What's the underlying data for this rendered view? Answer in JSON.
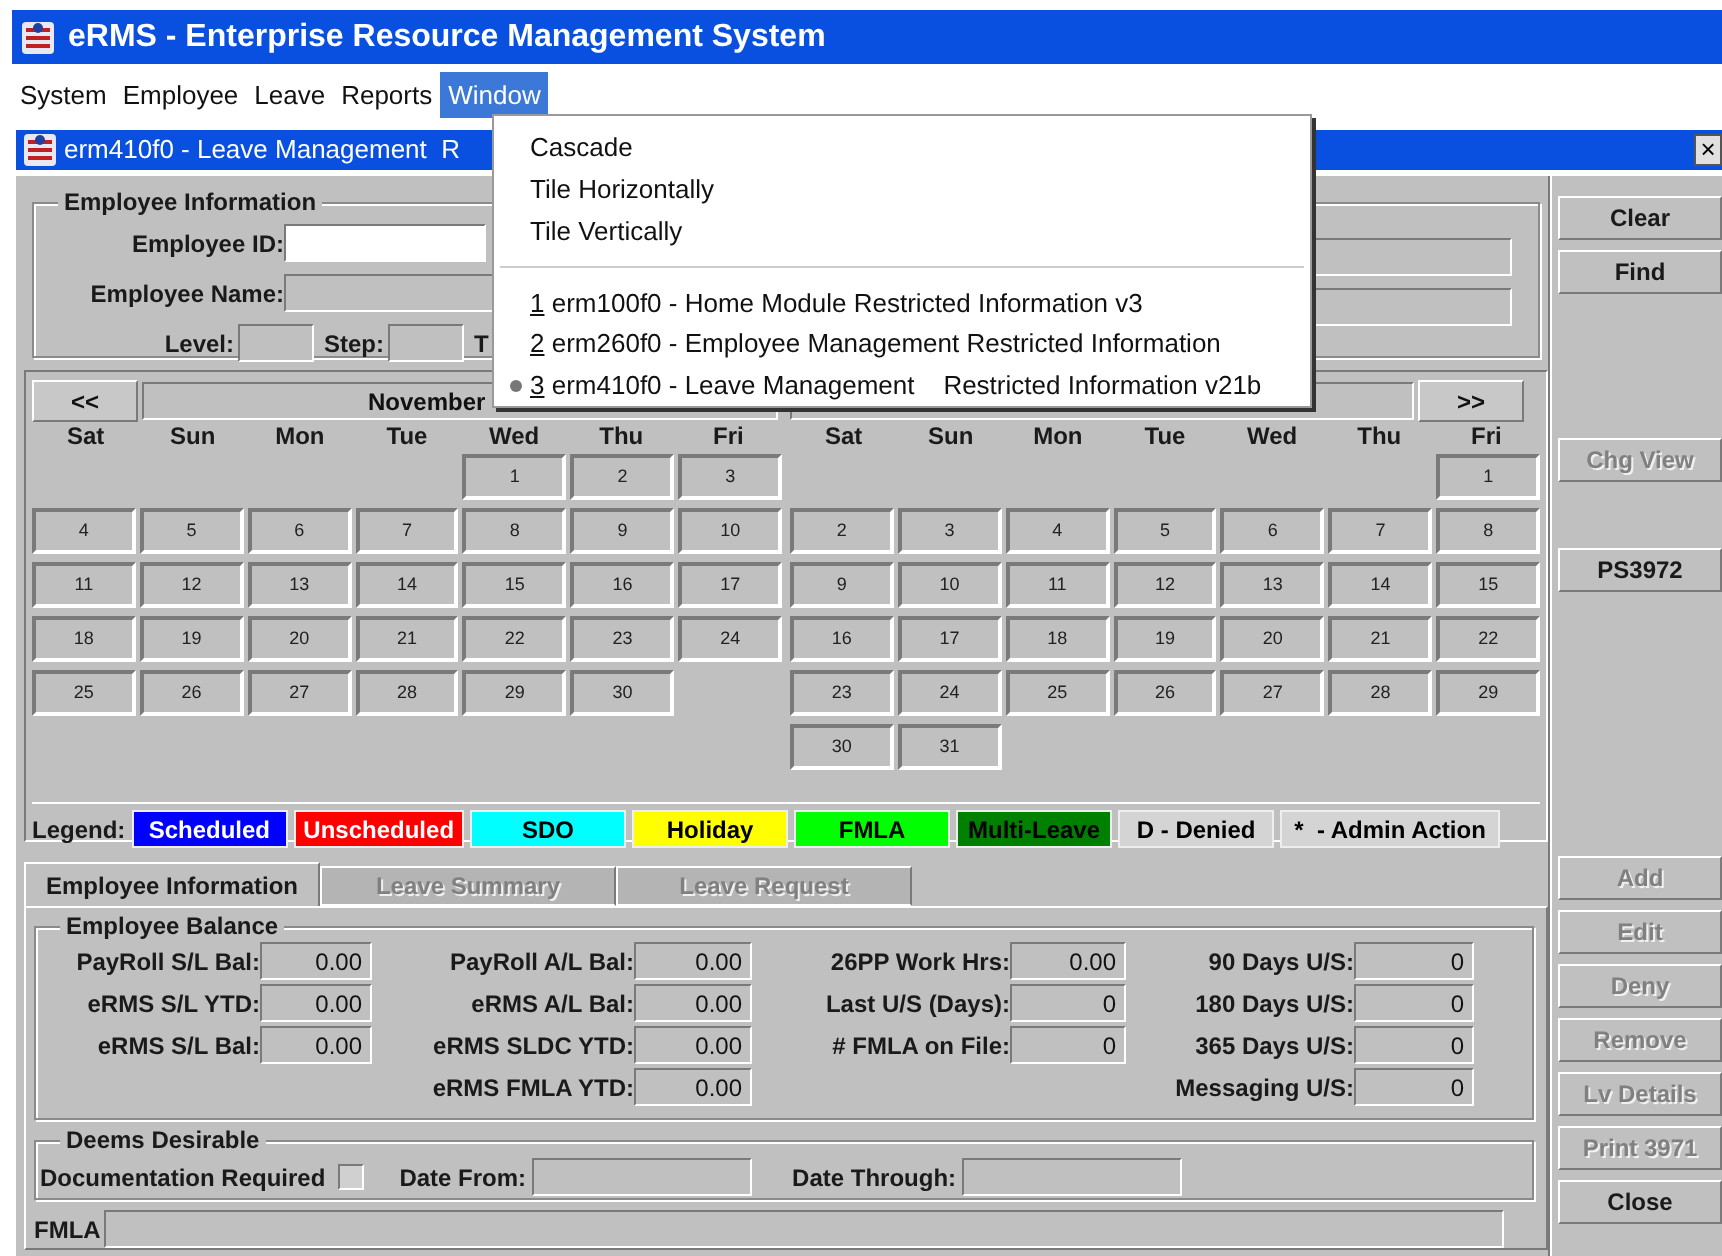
{
  "window": {
    "title": "eRMS - Enterprise Resource Management System"
  },
  "menu_bar": [
    {
      "label": "System",
      "selected": false
    },
    {
      "label": "Employee",
      "selected": false
    },
    {
      "label": "Leave",
      "selected": false
    },
    {
      "label": "Reports",
      "selected": false
    },
    {
      "label": "Window",
      "selected": true
    }
  ],
  "window_menu": {
    "commands": [
      "Cascade",
      "Tile Horizontally",
      "Tile Vertically"
    ],
    "windows": [
      {
        "mnemonic": "1",
        "label": "erm100f0 - Home Module Restricted Information v3",
        "active": false
      },
      {
        "mnemonic": "2",
        "label": "erm260f0 - Employee Management Restricted Information",
        "active": false
      },
      {
        "mnemonic": "3",
        "label": "erm410f0 - Leave Management    Restricted Information v21b",
        "active": true
      }
    ]
  },
  "inner_window": {
    "title": "erm410f0 - Leave Management  R",
    "close": "×"
  },
  "employee_information": {
    "title": "Employee Information",
    "id_label": "Employee ID:",
    "name_label": "Employee Name:",
    "level_label": "Level:",
    "step_label": "Step:",
    "label_4": "T"
  },
  "calendar": {
    "prev": "<<",
    "next": ">>",
    "months": [
      {
        "header": "November",
        "weekdays": [
          "Sat",
          "Sun",
          "Mon",
          "Tue",
          "Wed",
          "Thu",
          "Fri"
        ],
        "weeks": [
          [
            {
              "kind": "blank"
            },
            {
              "kind": "blank"
            },
            {
              "kind": "blank"
            },
            {
              "kind": "blank"
            },
            {
              "kind": "day",
              "label": "1"
            },
            {
              "kind": "day",
              "label": "2"
            },
            {
              "kind": "day",
              "label": "3"
            }
          ],
          [
            {
              "kind": "day",
              "label": "4"
            },
            {
              "kind": "day",
              "label": "5"
            },
            {
              "kind": "day",
              "label": "6"
            },
            {
              "kind": "day",
              "label": "7"
            },
            {
              "kind": "day",
              "label": "8"
            },
            {
              "kind": "day",
              "label": "9"
            },
            {
              "kind": "day",
              "label": "10"
            }
          ],
          [
            {
              "kind": "day",
              "label": "11"
            },
            {
              "kind": "day",
              "label": "12"
            },
            {
              "kind": "day",
              "label": "13"
            },
            {
              "kind": "day",
              "label": "14"
            },
            {
              "kind": "day",
              "label": "15"
            },
            {
              "kind": "day",
              "label": "16"
            },
            {
              "kind": "day",
              "label": "17"
            }
          ],
          [
            {
              "kind": "day",
              "label": "18"
            },
            {
              "kind": "day",
              "label": "19"
            },
            {
              "kind": "day",
              "label": "20"
            },
            {
              "kind": "day",
              "label": "21"
            },
            {
              "kind": "day",
              "label": "22"
            },
            {
              "kind": "day",
              "label": "23"
            },
            {
              "kind": "day",
              "label": "24"
            }
          ],
          [
            {
              "kind": "day",
              "label": "25"
            },
            {
              "kind": "day",
              "label": "26"
            },
            {
              "kind": "day",
              "label": "27"
            },
            {
              "kind": "day",
              "label": "28"
            },
            {
              "kind": "day",
              "label": "29"
            },
            {
              "kind": "day",
              "label": "30"
            },
            {
              "kind": "blank"
            }
          ]
        ]
      },
      {
        "weekdays": [
          "Sat",
          "Sun",
          "Mon",
          "Tue",
          "Wed",
          "Thu",
          "Fri"
        ],
        "weeks": [
          [
            {
              "kind": "blank"
            },
            {
              "kind": "blank"
            },
            {
              "kind": "blank"
            },
            {
              "kind": "blank"
            },
            {
              "kind": "blank"
            },
            {
              "kind": "blank"
            },
            {
              "kind": "day",
              "label": "1"
            }
          ],
          [
            {
              "kind": "day",
              "label": "2"
            },
            {
              "kind": "day",
              "label": "3"
            },
            {
              "kind": "day",
              "label": "4"
            },
            {
              "kind": "day",
              "label": "5"
            },
            {
              "kind": "day",
              "label": "6"
            },
            {
              "kind": "day",
              "label": "7"
            },
            {
              "kind": "day",
              "label": "8"
            }
          ],
          [
            {
              "kind": "day",
              "label": "9"
            },
            {
              "kind": "day",
              "label": "10"
            },
            {
              "kind": "day",
              "label": "11"
            },
            {
              "kind": "day",
              "label": "12"
            },
            {
              "kind": "day",
              "label": "13"
            },
            {
              "kind": "day",
              "label": "14"
            },
            {
              "kind": "day",
              "label": "15"
            }
          ],
          [
            {
              "kind": "day",
              "label": "16"
            },
            {
              "kind": "day",
              "label": "17"
            },
            {
              "kind": "day",
              "label": "18"
            },
            {
              "kind": "day",
              "label": "19"
            },
            {
              "kind": "day",
              "label": "20"
            },
            {
              "kind": "day",
              "label": "21"
            },
            {
              "kind": "day",
              "label": "22"
            }
          ],
          [
            {
              "kind": "day",
              "label": "23"
            },
            {
              "kind": "day",
              "label": "24"
            },
            {
              "kind": "day",
              "label": "25"
            },
            {
              "kind": "day",
              "label": "26"
            },
            {
              "kind": "day",
              "label": "27"
            },
            {
              "kind": "day",
              "label": "28"
            },
            {
              "kind": "day",
              "label": "29"
            }
          ],
          [
            {
              "kind": "day",
              "label": "30"
            },
            {
              "kind": "day",
              "label": "31"
            },
            {
              "kind": "blank"
            },
            {
              "kind": "blank"
            },
            {
              "kind": "blank"
            },
            {
              "kind": "blank"
            },
            {
              "kind": "blank"
            }
          ]
        ]
      }
    ]
  },
  "legend": {
    "label": "Legend:",
    "items": [
      {
        "label": "Scheduled",
        "color": "#0000ff"
      },
      {
        "label": "Unscheduled",
        "color": "#ff0000"
      },
      {
        "label": "SDO",
        "color": "#00ffff"
      },
      {
        "label": "Holiday",
        "color": "#ffff00"
      },
      {
        "label": "FMLA",
        "color": "#00ff00"
      },
      {
        "label": "Multi-Leave",
        "color": "#008000"
      },
      {
        "label": "D - Denied",
        "color": "#d4d4d4"
      },
      {
        "label": "*  - Admin Action",
        "color": "#d4d4d4"
      }
    ]
  },
  "tabs": [
    {
      "label": "Employee Information",
      "selected": true,
      "disabled": false
    },
    {
      "label": "Leave Summary",
      "selected": false,
      "disabled": true
    },
    {
      "label": "Leave Request",
      "selected": false,
      "disabled": true
    }
  ],
  "employee_balance": {
    "title": "Employee Balance",
    "columns": [
      [
        {
          "label": "PayRoll S/L Bal:",
          "value": "0.00"
        },
        {
          "label": "eRMS S/L YTD:",
          "value": "0.00"
        },
        {
          "label": "eRMS S/L Bal:",
          "value": "0.00"
        }
      ],
      [
        {
          "label": "PayRoll A/L Bal:",
          "value": "0.00"
        },
        {
          "label": "eRMS A/L Bal:",
          "value": "0.00"
        },
        {
          "label": "eRMS SLDC YTD:",
          "value": "0.00"
        },
        {
          "label": "eRMS FMLA YTD:",
          "value": "0.00"
        }
      ],
      [
        {
          "label": "26PP Work Hrs:",
          "value": "0.00"
        },
        {
          "label": "Last U/S (Days):",
          "value": "0"
        },
        {
          "label": "# FMLA on File:",
          "value": "0"
        }
      ],
      [
        {
          "label": "90 Days U/S:",
          "value": "0"
        },
        {
          "label": "180 Days U/S:",
          "value": "0"
        },
        {
          "label": "365 Days U/S:",
          "value": "0"
        },
        {
          "label": "Messaging U/S:",
          "value": "0"
        }
      ]
    ]
  },
  "deems_desirable": {
    "title": "Deems Desirable",
    "documentation_label": "Documentation Required",
    "documentation_checked": false,
    "date_from_label": "Date From:",
    "date_through_label": "Date Through:"
  },
  "fmla": {
    "label": "FMLA"
  },
  "side_buttons": [
    {
      "label": "Clear",
      "disabled": false
    },
    {
      "label": "Find",
      "disabled": false
    },
    {
      "label": "Chg View",
      "disabled": true
    },
    {
      "label": "PS3972",
      "disabled": false
    },
    {
      "label": "Add",
      "disabled": true
    },
    {
      "label": "Edit",
      "disabled": true
    },
    {
      "label": "Deny",
      "disabled": true
    },
    {
      "label": "Remove",
      "disabled": true
    },
    {
      "label": "Lv Details",
      "disabled": true
    },
    {
      "label": "Print 3971",
      "disabled": true
    },
    {
      "label": "Close",
      "disabled": false
    }
  ]
}
